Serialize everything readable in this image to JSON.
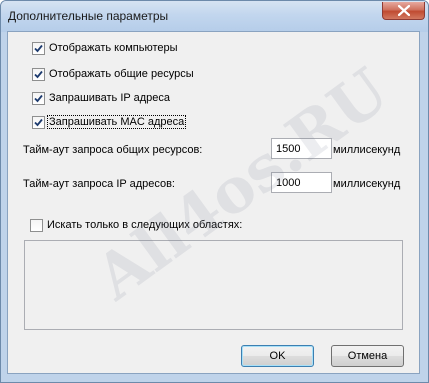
{
  "window": {
    "title": "Дополнительные параметры",
    "close_icon": "close-x-icon"
  },
  "options": [
    {
      "label": "Отображать компьютеры",
      "checked": true
    },
    {
      "label": "Отображать общие ресурсы",
      "checked": true
    },
    {
      "label": "Запрашивать IP адреса",
      "checked": true
    },
    {
      "label": "Запрашивать MAC адреса",
      "checked": true
    }
  ],
  "timeouts": {
    "shares": {
      "label": "Тайм-аут запроса общих ресурсов:",
      "value": "1500",
      "unit": "миллисекунд"
    },
    "ip": {
      "label": "Тайм-аут запроса IP адресов:",
      "value": "1000",
      "unit": "миллисекунд"
    }
  },
  "areas": {
    "label": "Искать только в следующих областях:",
    "checked": false
  },
  "buttons": {
    "ok": "OK",
    "cancel": "Отмена"
  },
  "watermark": "All4os.RU",
  "colors": {
    "titlebar": "#c2d6ee",
    "close_button": "#c04b32",
    "client_bg": "#f0f0f0",
    "default_button_border": "#3c7fb1"
  }
}
